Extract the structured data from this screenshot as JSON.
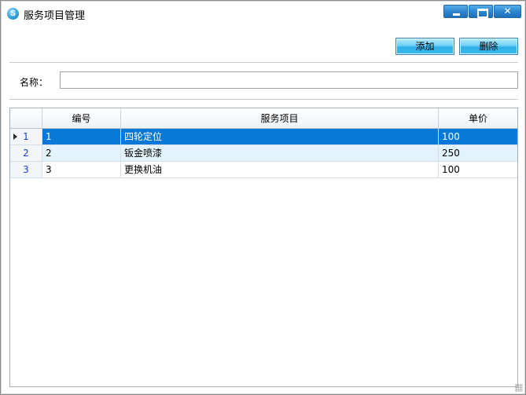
{
  "window": {
    "title": "服务项目管理",
    "app_icon_letter": "S",
    "controls": {
      "minimize_icon": "minimize-icon",
      "maximize_icon": "maximize-icon",
      "close_label": "✕"
    }
  },
  "toolbar": {
    "add_label": "添加",
    "delete_label": "删除"
  },
  "form": {
    "name_label": "名称：",
    "name_value": "",
    "name_placeholder": ""
  },
  "grid": {
    "columns": [
      "",
      "编号",
      "服务项目",
      "单价"
    ],
    "rows": [
      {
        "row_number": "1",
        "id": "1",
        "service": "四轮定位",
        "price": "100"
      },
      {
        "row_number": "2",
        "id": "2",
        "service": "钣金喷漆",
        "price": "250"
      },
      {
        "row_number": "3",
        "id": "3",
        "service": "更换机油",
        "price": "100"
      }
    ],
    "selected_row": 1
  },
  "colors": {
    "selected_row": "#0a78d6",
    "alt_row": "#e3f3fb",
    "title_button": "#2e86cf",
    "toolbar_button": "#36b9ee",
    "row_number_text": "#1a3fd0"
  }
}
